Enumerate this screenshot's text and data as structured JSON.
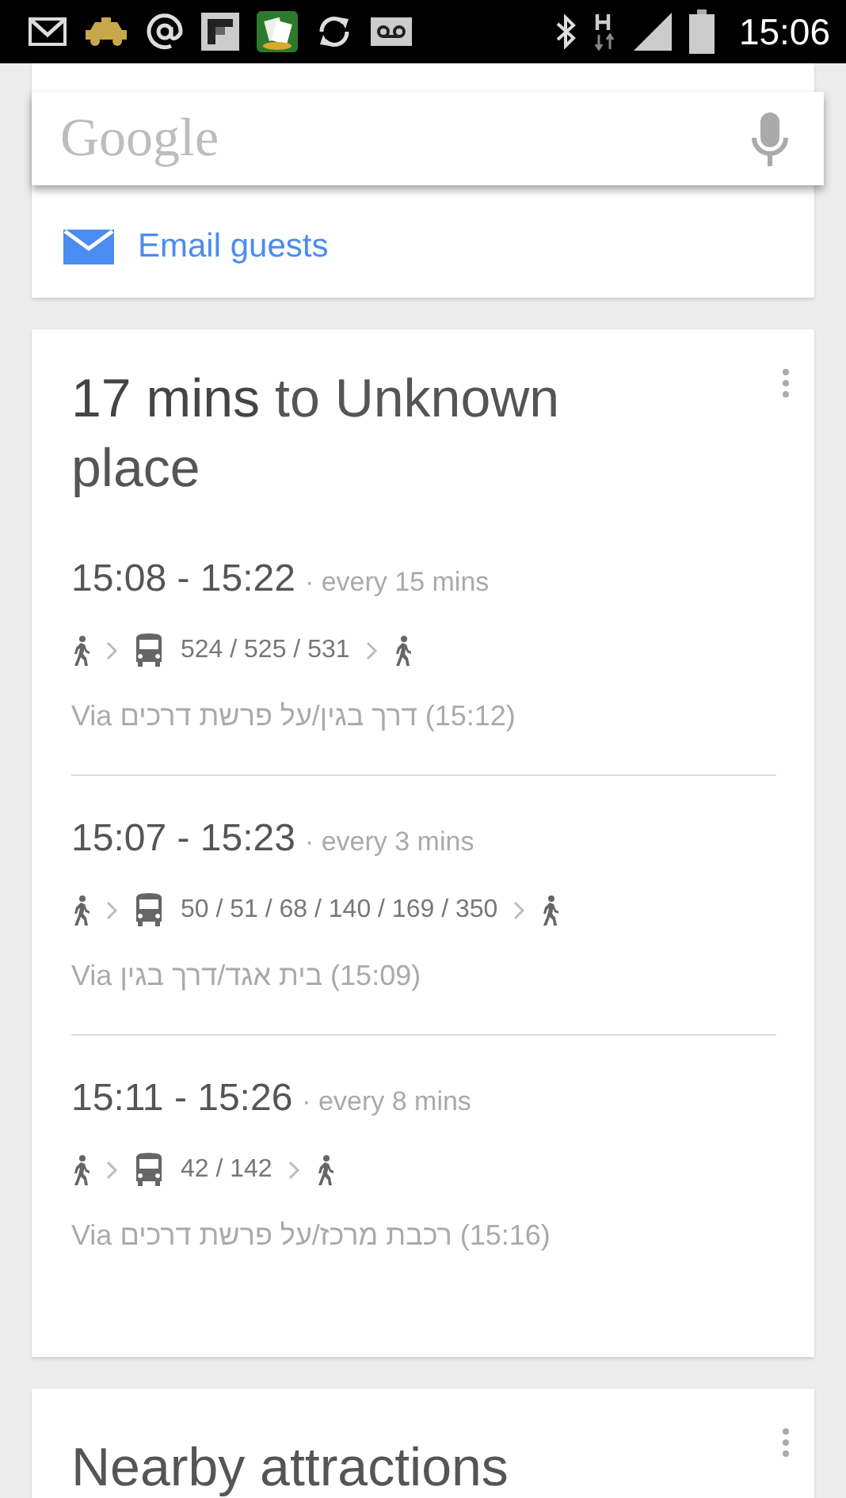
{
  "status_bar": {
    "time": "15:06"
  },
  "search": {
    "logo": "Google"
  },
  "event_card": {
    "action": "Email guests"
  },
  "transit_card": {
    "title_bold": "17 mins",
    "title_rest": "to Unknown place",
    "routes": [
      {
        "times": "15:08 - 15:22",
        "frequency": "· every 15 mins",
        "lines": "524 / 525 / 531",
        "via": "Via",
        "stop": "דרך בגין/על פרשת דרכים",
        "stop_time": "(15:12)"
      },
      {
        "times": "15:07 - 15:23",
        "frequency": "· every 3 mins",
        "lines": "50 / 51 / 68 / 140 / 169 / 350",
        "via": "Via",
        "stop": "בית אגד/דרך בגין",
        "stop_time": "(15:09)"
      },
      {
        "times": "15:11 - 15:26",
        "frequency": "· every 8 mins",
        "lines": "42 / 142",
        "via": "Via",
        "stop": "רכבת מרכז/על פרשת דרכים",
        "stop_time": "(15:16)"
      }
    ]
  },
  "next_card": {
    "title": "Nearby attractions"
  }
}
